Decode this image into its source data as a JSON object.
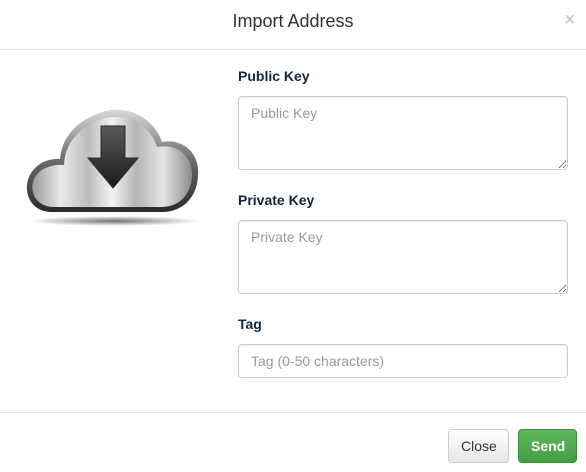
{
  "header": {
    "title": "Import Address",
    "close_glyph": "×"
  },
  "illustration": {
    "icon": "cloud-download-icon"
  },
  "form": {
    "public_key": {
      "label": "Public Key",
      "placeholder": "Public Key",
      "value": ""
    },
    "private_key": {
      "label": "Private Key",
      "placeholder": "Private Key",
      "value": ""
    },
    "tag": {
      "label": "Tag",
      "placeholder": "Tag (0-50 characters)",
      "value": ""
    }
  },
  "footer": {
    "close_label": "Close",
    "send_label": "Send"
  },
  "colors": {
    "label": "#10263f",
    "send_button": "#4cae4c",
    "divider": "#e5e5e5"
  }
}
